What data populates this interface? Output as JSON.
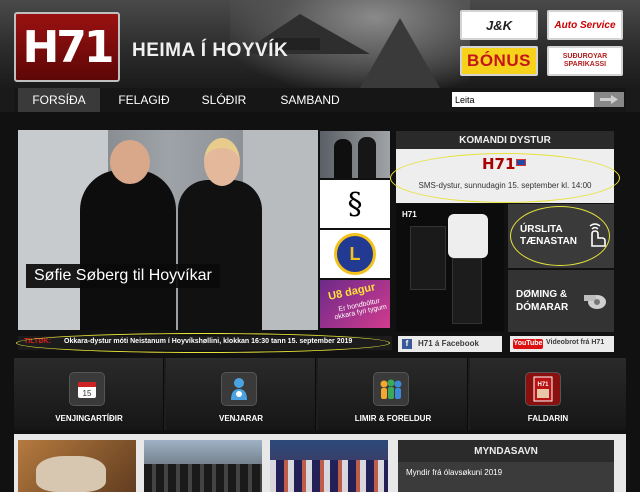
{
  "header": {
    "logo_text": "H71",
    "site_title": "HEIMA Í HOYVÍK",
    "sponsors": {
      "jk": "J&K",
      "auto": "Auto Service",
      "bonus": "BÓNUS",
      "spar": "SUÐUROYAR SPARIKASSI"
    }
  },
  "nav": {
    "items": [
      "FORSÍÐA",
      "FELAGIÐ",
      "SLÓÐIR",
      "SAMBAND"
    ],
    "active_index": 0,
    "search_placeholder": "Leita"
  },
  "hero": {
    "caption": "Søfie Søberg til Hoyvíkar",
    "thumb_section_symbol": "§",
    "thumb_lions_letter": "L",
    "thumb_u8_title": "U8 dagur",
    "thumb_u8_sub": "Er hondbóltur okkara fyri tygum"
  },
  "komandi": {
    "title": "KOMANDI DYSTUR",
    "logo": "H71",
    "text": "SMS-dystur, sunnudagin 15. september kl. 14:00"
  },
  "kit": {
    "logo": "H71"
  },
  "urslit": {
    "line1": "ÚRSLITA",
    "line2": "TÆNASTAN"
  },
  "doming": {
    "line1": "DØMING &",
    "line2": "DÓMARAR"
  },
  "ticker": {
    "label": "TILTØK:",
    "text": "Okkara-dystur móti Neistanum í Hoyvíkshøllini, klokkan 16:30 tann 15. september 2019"
  },
  "social": {
    "facebook_icon": "f",
    "facebook": "H71 á Facebook",
    "youtube_icon": "YouTube",
    "youtube": "Videobrot frá H71"
  },
  "quicklinks": [
    {
      "label": "VENJINGARTÍÐIR",
      "icon": "calendar-icon"
    },
    {
      "label": "VENJARAR",
      "icon": "coach-icon"
    },
    {
      "label": "LIMIR & FORELDUR",
      "icon": "members-icon"
    },
    {
      "label": "FALDARIN",
      "icon": "magazine-icon"
    }
  ],
  "myndasavn": {
    "title": "MYNDASAVN",
    "caption": "Myndir frá ólavsøkuni 2019"
  },
  "colors": {
    "brand_red": "#9a1111",
    "highlight_yellow": "#e6e23a",
    "facebook_blue": "#3b5998",
    "youtube_red": "#dd1111"
  }
}
